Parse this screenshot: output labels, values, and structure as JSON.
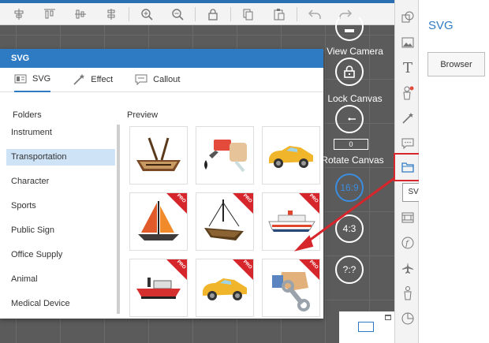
{
  "toolbar": {
    "icons": [
      "align-center-icon",
      "align-top-icon",
      "align-middle-icon",
      "align-bottom-icon",
      "zoom-in-icon",
      "zoom-out-icon",
      "lock-icon",
      "copy-icon",
      "paste-icon",
      "undo-icon",
      "redo-icon"
    ]
  },
  "canvas_controls": {
    "view_camera": "View Camera",
    "lock_canvas": "Lock Canvas",
    "rotation_value": "0",
    "rotate_canvas": "Rotate Canvas",
    "ratio_16_9": "16:9",
    "ratio_4_3": "4:3",
    "ratio_custom": "?:?"
  },
  "dialog": {
    "title": "SVG",
    "tabs": [
      {
        "label": "SVG",
        "icon": "svg-tab-icon"
      },
      {
        "label": "Effect",
        "icon": "magic-wand-icon"
      },
      {
        "label": "Callout",
        "icon": "speech-bubble-icon"
      }
    ],
    "folders_header": "Folders",
    "preview_header": "Preview",
    "folders": [
      "Instrument",
      "Transportation",
      "Character",
      "Sports",
      "Public Sign",
      "Office Supply",
      "Animal",
      "Medical Device"
    ],
    "selected_folder": "Transportation",
    "preview_items": [
      {
        "name": "rowboat",
        "pro": false
      },
      {
        "name": "fuel-pump",
        "pro": false
      },
      {
        "name": "yellow-car",
        "pro": false
      },
      {
        "name": "sailboat",
        "pro": true
      },
      {
        "name": "hanging-boat",
        "pro": true
      },
      {
        "name": "cruise-ship",
        "pro": true
      },
      {
        "name": "red-boat",
        "pro": true
      },
      {
        "name": "yellow-car-2",
        "pro": true
      },
      {
        "name": "wrench-hand",
        "pro": true
      }
    ],
    "pro_label": "PRO"
  },
  "strip": {
    "icons": [
      "shape-icon",
      "image-icon",
      "text-icon",
      "character-icon",
      "effect-icon",
      "callout-icon",
      "folder-icon",
      "film-icon",
      "function-icon",
      "plane-icon",
      "person-icon",
      "pie-chart-icon"
    ],
    "tooltip": "SVG"
  },
  "panel": {
    "title": "SVG",
    "browser_label": "Browser"
  },
  "colors": {
    "accent": "#2e7bc4",
    "highlight": "#d7262b",
    "canvas": "#5b5b5b"
  }
}
